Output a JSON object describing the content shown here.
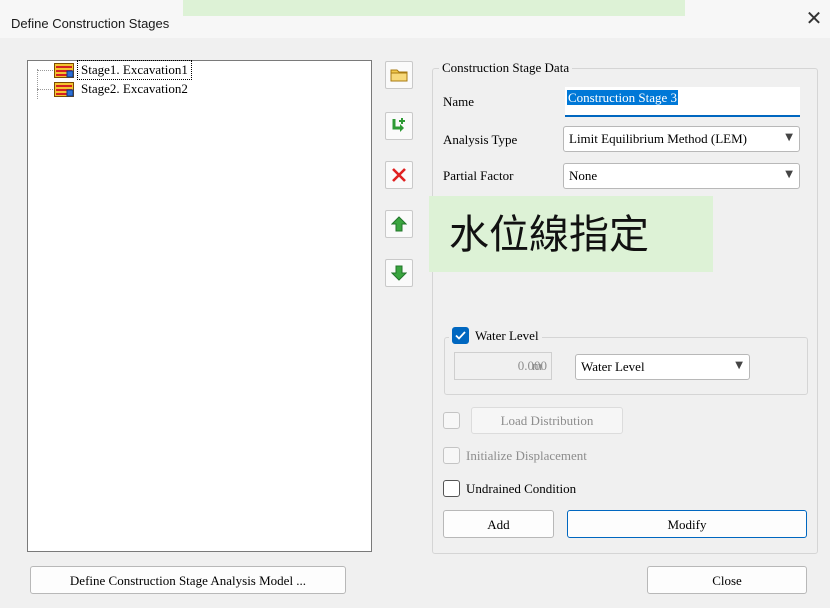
{
  "window": {
    "title": "Define Construction Stages",
    "close_glyph": "✕"
  },
  "overlays": {
    "top_label": "",
    "annotation": "水位線指定"
  },
  "tree": {
    "items": [
      {
        "label": "Stage1. Excavation1",
        "selected": true,
        "icon": "construction-stage-icon"
      },
      {
        "label": "Stage2. Excavation2",
        "selected": false,
        "icon": "construction-stage-icon"
      }
    ]
  },
  "toolbar": {
    "buttons": [
      {
        "name": "new-stage-button",
        "icon": "folder-icon"
      },
      {
        "name": "insert-stage-button",
        "icon": "insert-arrow-icon"
      },
      {
        "name": "delete-stage-button",
        "icon": "delete-x-icon"
      },
      {
        "name": "move-up-button",
        "icon": "arrow-up-icon"
      },
      {
        "name": "move-down-button",
        "icon": "arrow-down-icon"
      }
    ]
  },
  "stage_data": {
    "group_title": "Construction Stage Data",
    "name_label": "Name",
    "name_value": "Construction Stage 3",
    "analysis_type_label": "Analysis Type",
    "analysis_type_value": "Limit Equilibrium Method (LEM)",
    "partial_factor_label": "Partial Factor",
    "partial_factor_value": "None"
  },
  "water_level": {
    "checked": true,
    "label": "Water Level",
    "value": "0.000",
    "unit": "m",
    "combo_value": "Water Level"
  },
  "options": {
    "load_distribution": {
      "checked": false,
      "enabled": false,
      "label": "Load Distribution"
    },
    "initialize_displacement": {
      "checked": false,
      "enabled": false,
      "label": "Initialize Displacement"
    },
    "undrained_condition": {
      "checked": false,
      "enabled": true,
      "label": "Undrained Condition"
    }
  },
  "buttons": {
    "add": "Add",
    "modify": "Modify",
    "define_model": "Define Construction Stage Analysis Model ...",
    "close": "Close"
  },
  "colors": {
    "accent": "#0067c0",
    "overlay": "#ddf2d6",
    "selection": "#0078d7"
  }
}
